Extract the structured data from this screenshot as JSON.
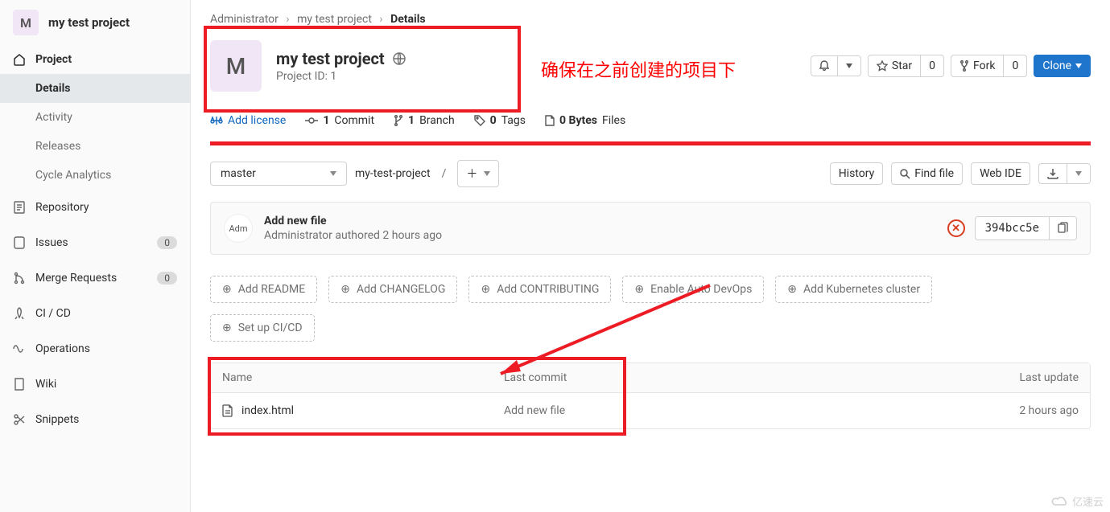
{
  "sidebar": {
    "avatar_letter": "M",
    "title": "my test project",
    "project_section": "Project",
    "subs": [
      "Details",
      "Activity",
      "Releases",
      "Cycle Analytics"
    ],
    "items": [
      {
        "label": "Repository",
        "badge": null
      },
      {
        "label": "Issues",
        "badge": "0"
      },
      {
        "label": "Merge Requests",
        "badge": "0"
      },
      {
        "label": "CI / CD",
        "badge": null
      },
      {
        "label": "Operations",
        "badge": null
      },
      {
        "label": "Wiki",
        "badge": null
      },
      {
        "label": "Snippets",
        "badge": null
      }
    ]
  },
  "breadcrumb": {
    "a": "Administrator",
    "b": "my test project",
    "c": "Details"
  },
  "project": {
    "avatar_letter": "M",
    "name": "my test project",
    "id_label": "Project ID: 1",
    "annotation": "确保在之前创建的项目下",
    "star_label": "Star",
    "star_count": "0",
    "fork_label": "Fork",
    "fork_count": "0",
    "clone_label": "Clone"
  },
  "stats": {
    "license": "Add license",
    "commits_n": "1",
    "commits": "Commit",
    "branches_n": "1",
    "branches": "Branch",
    "tags_n": "0",
    "tags": "Tags",
    "files_n": "0 Bytes",
    "files": "Files"
  },
  "toolbar": {
    "branch": "master",
    "path": "my-test-project",
    "history": "History",
    "find_file": "Find file",
    "web_ide": "Web IDE"
  },
  "commit": {
    "avatar": "Adm",
    "title": "Add new file",
    "author": "Administrator authored 2 hours ago",
    "sha": "394bcc5e"
  },
  "quick": [
    "Add README",
    "Add CHANGELOG",
    "Add CONTRIBUTING",
    "Enable Auto DevOps",
    "Add Kubernetes cluster",
    "Set up CI/CD"
  ],
  "table": {
    "h_name": "Name",
    "h_commit": "Last commit",
    "h_update": "Last update",
    "rows": [
      {
        "name": "index.html",
        "commit": "Add new file",
        "update": "2 hours ago"
      }
    ]
  },
  "watermark": "亿速云"
}
